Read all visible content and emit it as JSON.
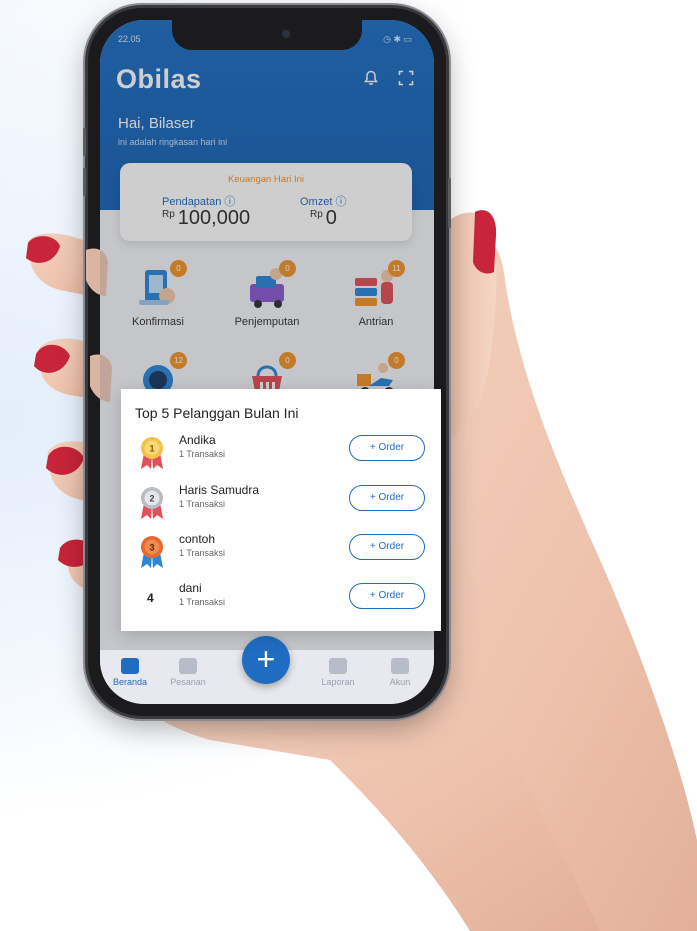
{
  "status_bar": {
    "time": "22.05",
    "icons": "◷ ✱ ▭"
  },
  "app": {
    "name": "Obilas",
    "greeting": "Hai, Bilaser",
    "greeting_sub": "ini adalah ringkasan hari ini"
  },
  "finance": {
    "title": "Keuangan Hari Ini",
    "income_label": "Pendapatan ⓘ",
    "income_currency": "Rp",
    "income_value": "100,000",
    "turnover_label": "Omzet ⓘ",
    "turnover_currency": "Rp",
    "turnover_value": "0"
  },
  "menu": [
    {
      "label": "Konfirmasi",
      "badge": "0",
      "icon": "confirm-icon"
    },
    {
      "label": "Penjemputan",
      "badge": "0",
      "icon": "pickup-icon"
    },
    {
      "label": "Antrian",
      "badge": "11",
      "icon": "queue-icon"
    },
    {
      "label": "",
      "badge": "12",
      "icon": "washing-icon"
    },
    {
      "label": "",
      "badge": "0",
      "icon": "basket-icon"
    },
    {
      "label": "",
      "badge": "0",
      "icon": "delivery-icon"
    }
  ],
  "bottom_nav": [
    {
      "label": "Beranda",
      "icon": "home-icon",
      "active": true
    },
    {
      "label": "Pesanan",
      "icon": "orders-icon",
      "active": false
    },
    {
      "label": "Laporan",
      "icon": "report-icon",
      "active": false
    },
    {
      "label": "Akun",
      "icon": "account-icon",
      "active": false
    }
  ],
  "fab_label": "+",
  "top_customers": {
    "title": "Top 5 Pelanggan Bulan Ini",
    "order_label": "+ Order",
    "rows": [
      {
        "rank": "1",
        "name": "Andika",
        "sub": "1 Transaksi",
        "medal": "gold"
      },
      {
        "rank": "2",
        "name": "Haris Samudra",
        "sub": "1 Transaksi",
        "medal": "silver"
      },
      {
        "rank": "3",
        "name": "contoh",
        "sub": "1 Transaksi",
        "medal": "bronze"
      },
      {
        "rank": "4",
        "name": "dani",
        "sub": "1 Transaksi",
        "medal": "none"
      }
    ]
  },
  "colors": {
    "brand_blue": "#1f6cc0",
    "accent_orange": "#f2952b",
    "nail_red": "#c8243a"
  }
}
